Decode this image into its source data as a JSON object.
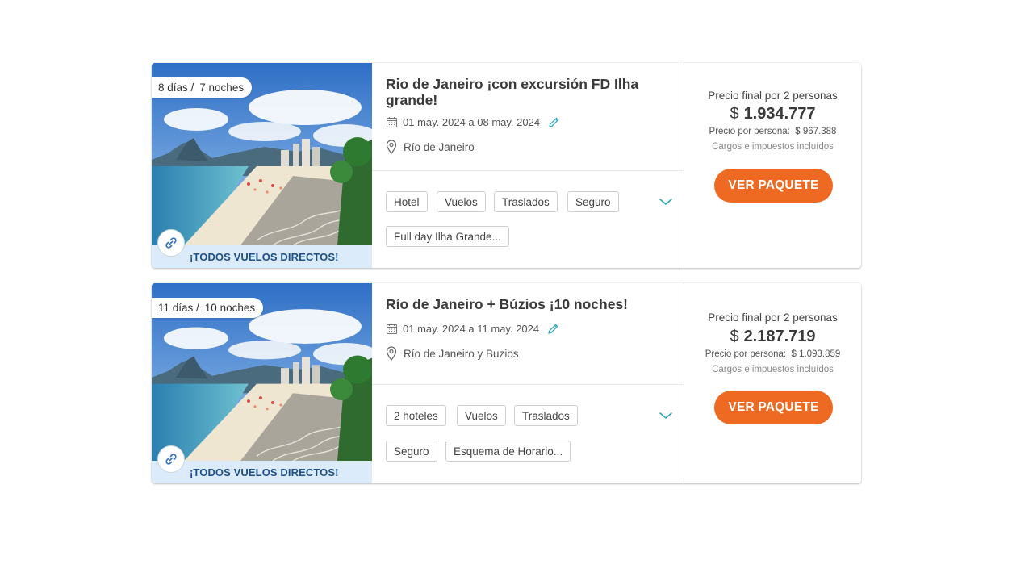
{
  "colors": {
    "accent": "#ee6a23",
    "link": "#2aa7b8",
    "band": "#dcebfa",
    "band_text": "#1c4f8a"
  },
  "packages": [
    {
      "duration_days": "8 días /",
      "duration_nights": "7 noches",
      "direct_flights": "¡TODOS VUELOS DIRECTOS!",
      "title": "Rio de Janeiro ¡con excursión FD Ilha grande!",
      "dates": "01 may. 2024 a 08 may. 2024",
      "location": "Río de Janeiro",
      "services": [
        "Hotel",
        "Vuelos",
        "Traslados",
        "Seguro",
        "Full day Ilha Grande..."
      ],
      "price_label": "Precio final por 2 personas",
      "currency": "$",
      "total": "1.934.777",
      "per_person_label": "Precio por persona:",
      "per_person": "$ 967.388",
      "taxes": "Cargos e impuestos incluídos",
      "cta": "VER PAQUETE"
    },
    {
      "duration_days": "11 días /",
      "duration_nights": "10 noches",
      "direct_flights": "¡TODOS VUELOS DIRECTOS!",
      "title": "Río de Janeiro + Búzios ¡10 noches!",
      "dates": "01 may. 2024 a 11 may. 2024",
      "location": "Río de Janeiro y Buzios",
      "services": [
        "2 hoteles",
        "Vuelos",
        "Traslados",
        "Seguro",
        "Esquema de Horario..."
      ],
      "price_label": "Precio final por 2 personas",
      "currency": "$",
      "total": "2.187.719",
      "per_person_label": "Precio por persona:",
      "per_person": "$ 1.093.859",
      "taxes": "Cargos e impuestos incluídos",
      "cta": "VER PAQUETE"
    }
  ]
}
